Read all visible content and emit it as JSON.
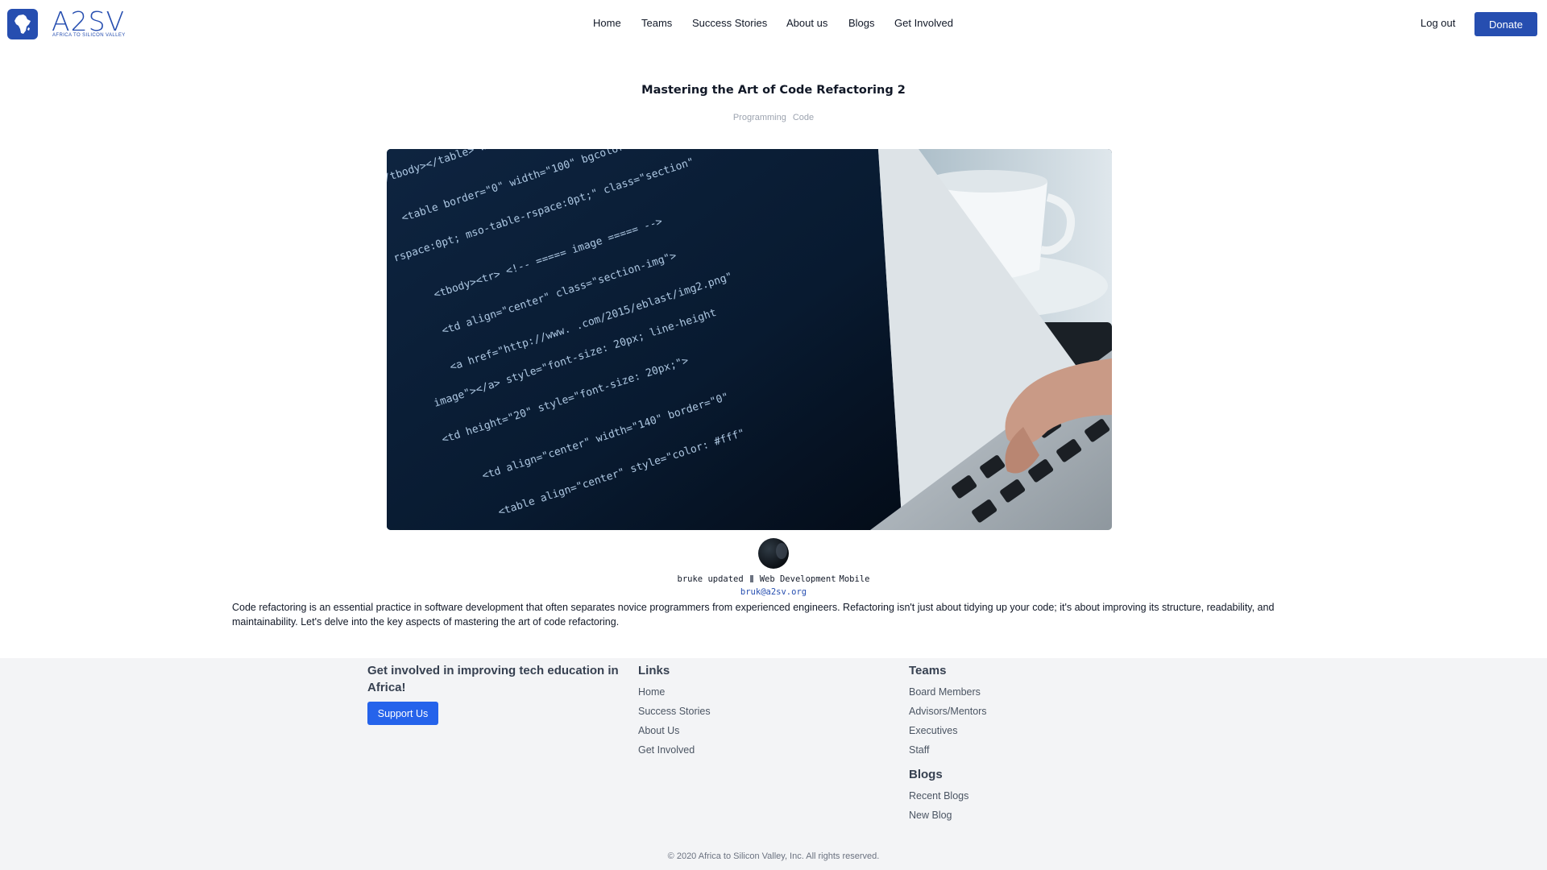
{
  "brand": {
    "name": "A2SV",
    "tagline": "AFRICA TO SILICON VALLEY",
    "color": "#264eb0"
  },
  "nav": {
    "items": [
      {
        "label": "Home"
      },
      {
        "label": "Teams"
      },
      {
        "label": "Success Stories"
      },
      {
        "label": "About us"
      },
      {
        "label": "Blogs"
      },
      {
        "label": "Get Involved"
      }
    ],
    "logout_label": "Log out",
    "donate_label": "Donate"
  },
  "article": {
    "title": "Mastering the Art of Code Refactoring 2",
    "tags": [
      "Programming",
      "Code"
    ],
    "author": {
      "name": "bruke updated",
      "skills": [
        "Web Development",
        "Mobile"
      ],
      "email": "bruk@a2sv.org"
    },
    "body": "Code refactoring is an essential practice in software development that often separates novice programmers from experienced engineers. Refactoring isn't just about tidying up your code; it's about improving its structure, readability, and maintainability. Let's delve into the key aspects of mastering the art of code refactoring."
  },
  "footer": {
    "cta_heading": "Get involved in improving tech education in Africa!",
    "support_label": "Support Us",
    "links_heading": "Links",
    "links": [
      "Home",
      "Success Stories",
      "About Us",
      "Get Involved"
    ],
    "teams_heading": "Teams",
    "teams": [
      "Board Members",
      "Advisors/Mentors",
      "Executives",
      "Staff"
    ],
    "blogs_heading": "Blogs",
    "blogs": [
      "Recent Blogs",
      "New Blog"
    ],
    "copyright": "© 2020 Africa to Silicon Valley, Inc. All rights reserved."
  }
}
